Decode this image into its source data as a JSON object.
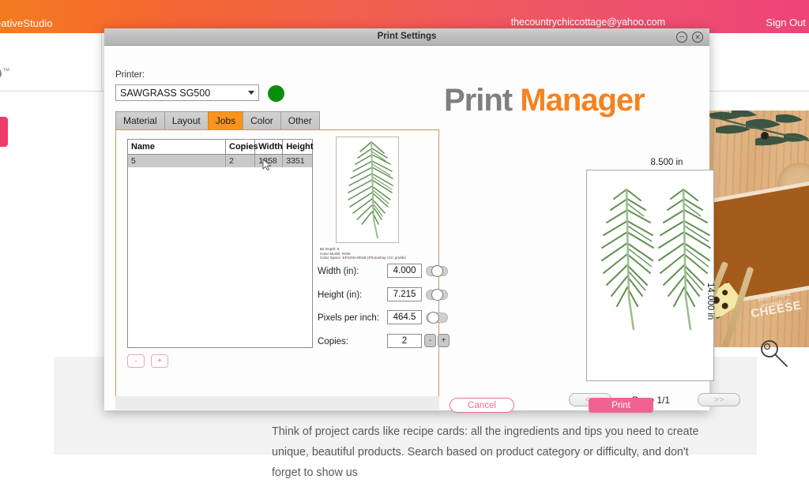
{
  "webpage": {
    "brand": "eativeStudio",
    "email": "thecountrychiccottage@yahoo.com",
    "sign_out": "Sign Out",
    "logo_fragment": "O",
    "logo_tm": "™",
    "body_paragraph": "Think of project cards like recipe cards: all the ingredients and tips you need to create unique, beautiful products. Search based on product category or difficulty, and don't forget to show us",
    "hero_card": {
      "script_line": "Sweet Dreams",
      "small_line": "are made of",
      "big_line": "CHEESE"
    },
    "accent_pink": "#ee3e68",
    "header_gradient_start": "#f47b20",
    "header_gradient_end": "#ed4377"
  },
  "dialog": {
    "title": "Print Settings",
    "minimize_icon": "⊖",
    "close_icon": "⊗",
    "printer_label": "Printer:",
    "printer_value": "SAWGRASS SG500",
    "printer_status_color": "#0a8f0a",
    "logo_part1": "Print",
    "logo_part2": "Manager",
    "logo_gray": "#7f7f7f",
    "logo_orange": "#f58220",
    "tabs": [
      {
        "label": "Material",
        "active": false
      },
      {
        "label": "Layout",
        "active": false
      },
      {
        "label": "Jobs",
        "active": true
      },
      {
        "label": "Color",
        "active": false
      },
      {
        "label": "Other",
        "active": false
      }
    ],
    "active_tab_color": "#f7931e",
    "jobs_table": {
      "columns": [
        "Name",
        "Copies",
        "Width",
        "Height"
      ],
      "rows": [
        {
          "name": "5",
          "copies": "2",
          "width": "1858",
          "height": "3351"
        }
      ]
    },
    "list_buttons": {
      "remove": "-",
      "add": "+"
    },
    "image_info": {
      "bit_depth": "Bit Depth: 8",
      "color_model": "Color Model: RGB",
      "color_space": "Color Space: EPSON  sRGB (Photoshop ICC profile)"
    },
    "properties": [
      {
        "label": "Width (in):",
        "value": "4.000",
        "toggle": "mid"
      },
      {
        "label": "Height (in):",
        "value": "7.215",
        "toggle": "mid"
      },
      {
        "label": "Pixels per inch:",
        "value": "464.5",
        "toggle": "left"
      }
    ],
    "copies": {
      "label": "Copies:",
      "value": "2",
      "minus": "-",
      "plus": "+"
    },
    "preview": {
      "width_label": "8.500 in",
      "height_label": "14.000 in",
      "page_label": "Page 1/1",
      "prev_label": "<<",
      "next_label": ">>",
      "zoom_icon": "magnifier-icon"
    },
    "cancel_label": "Cancel",
    "print_label": "Print",
    "cancel_color": "#ef6d8c",
    "print_color": "#f06292"
  }
}
